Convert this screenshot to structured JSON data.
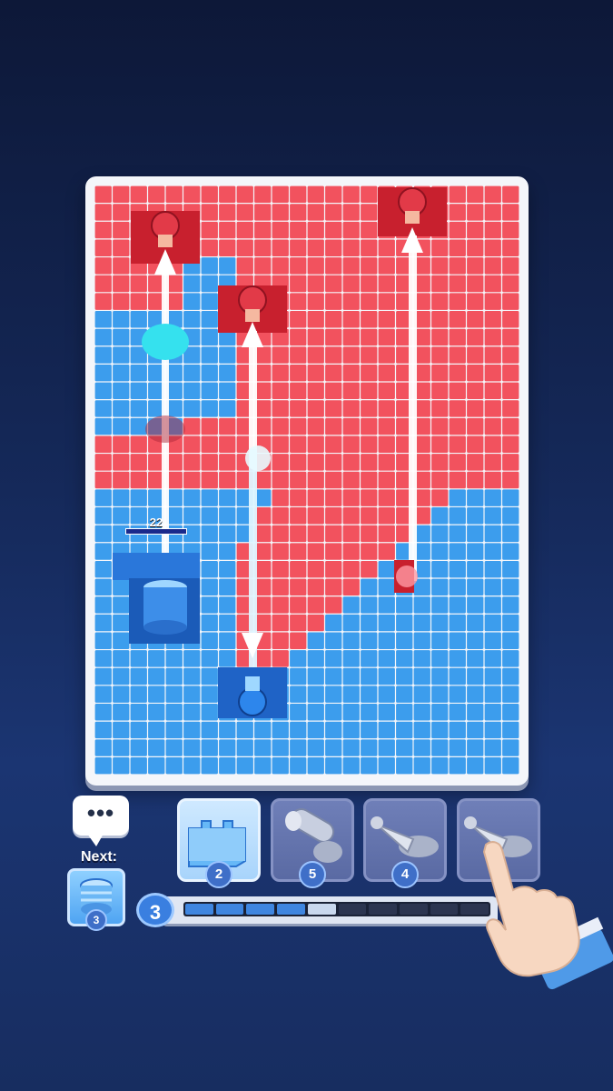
{
  "board": {
    "turrets": [
      {
        "team": "red",
        "label": "red-turret-1"
      },
      {
        "team": "red",
        "label": "red-turret-2"
      },
      {
        "team": "red",
        "label": "red-turret-3"
      },
      {
        "team": "blue",
        "label": "blue-turret"
      }
    ],
    "tower_hp": "22"
  },
  "hud": {
    "chat_dots": "•••",
    "next_label": "Next:",
    "next_count": "3",
    "slots": [
      {
        "name": "wall",
        "count": "2",
        "state": "active"
      },
      {
        "name": "cannon",
        "count": "5",
        "state": "locked"
      },
      {
        "name": "drill",
        "count": "4",
        "state": "locked"
      },
      {
        "name": "drill",
        "count": "",
        "state": "locked"
      }
    ],
    "level": "3",
    "progress": {
      "filled": 4,
      "partial": 1,
      "total": 10
    }
  },
  "colors": {
    "red": "#f2525e",
    "blue": "#3c9ded",
    "accent": "#3f86e0"
  }
}
